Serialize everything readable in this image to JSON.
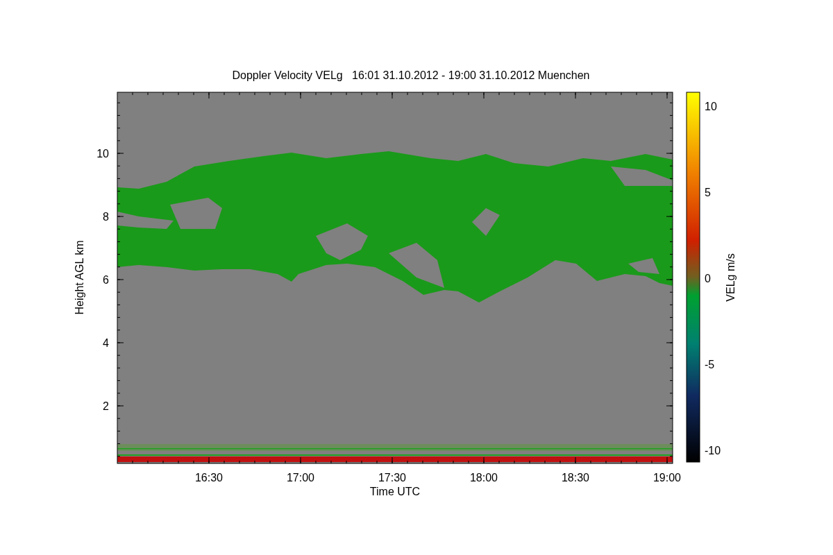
{
  "title": "Doppler Velocity VELg   16:01 31.10.2012 - 19:00 31.10.2012 Muenchen",
  "xlabel": "Time UTC",
  "ylabel": "Height AGL km",
  "xticks": [
    "16:30",
    "17:00",
    "17:30",
    "18:00",
    "18:30",
    "19:00"
  ],
  "yticks": [
    "10",
    "8",
    "6",
    "4",
    "2"
  ],
  "colorbar": {
    "label": "VELg m/s",
    "ticks": [
      "10",
      "5",
      "0",
      "-5",
      "-10"
    ]
  }
}
